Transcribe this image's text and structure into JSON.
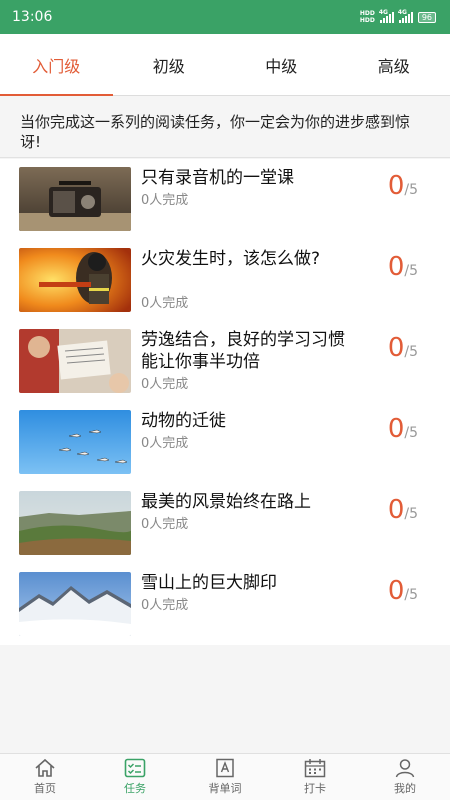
{
  "status_bar": {
    "time": "13:06",
    "network1": "4G",
    "network2": "4G",
    "hd": "HD",
    "battery": "96"
  },
  "tabs": [
    {
      "label": "入门级",
      "active": true
    },
    {
      "label": "初级",
      "active": false
    },
    {
      "label": "中级",
      "active": false
    },
    {
      "label": "高级",
      "active": false
    }
  ],
  "intro": "当你完成这一系列的阅读任务，你一定会为你的进步感到惊讶!",
  "lessons": [
    {
      "title": "只有录音机的一堂课",
      "completed": "0人完成",
      "score": "0",
      "total": "/5",
      "image": "radio-photo"
    },
    {
      "title": "火灾发生时，该怎么做?",
      "completed": "0人完成",
      "score": "0",
      "total": "/5",
      "image": "firefighter-photo"
    },
    {
      "title": "劳逸结合，良好的学习习惯能让你事半功倍",
      "completed": "0人完成",
      "score": "0",
      "total": "/5",
      "image": "study-photo"
    },
    {
      "title": "动物的迁徙",
      "completed": "0人完成",
      "score": "0",
      "total": "/5",
      "image": "birds-photo"
    },
    {
      "title": "最美的风景始终在路上",
      "completed": "0人完成",
      "score": "0",
      "total": "/5",
      "image": "landscape-photo"
    },
    {
      "title": "雪山上的巨大脚印",
      "completed": "0人完成",
      "score": "0",
      "total": "/5",
      "image": "snow-mountain-photo"
    }
  ],
  "bottom_nav": [
    {
      "label": "首页",
      "icon": "home-icon",
      "active": false
    },
    {
      "label": "任务",
      "icon": "task-icon",
      "active": true
    },
    {
      "label": "背单词",
      "icon": "vocabulary-icon",
      "active": false
    },
    {
      "label": "打卡",
      "icon": "calendar-icon",
      "active": false
    },
    {
      "label": "我的",
      "icon": "user-icon",
      "active": false
    }
  ],
  "colors": {
    "brand_green": "#3aa266",
    "accent_orange": "#e25c37"
  }
}
